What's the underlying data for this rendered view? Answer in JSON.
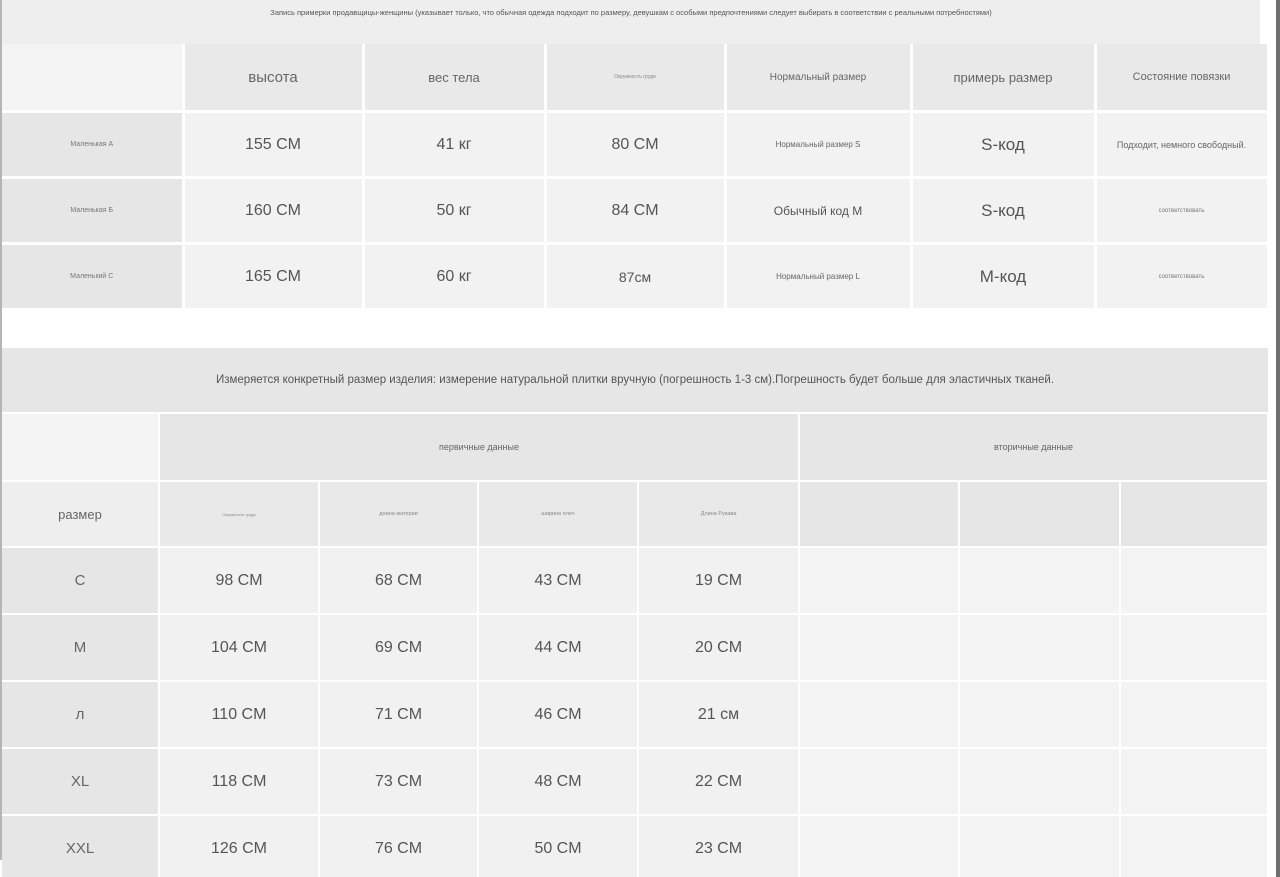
{
  "fitting_note": "Запись примерки продавщицы-женщины (указывает только, что обычная одежда подходит по размеру, девушкам с особыми предпочтениями следует выбирать в соответствии с реальными потребностями)",
  "fitting_table": {
    "headers": [
      "",
      "высота",
      "вес тела",
      "Окружность груди",
      "Нормальный размер",
      "примерь размер",
      "Состояние повязки"
    ],
    "rows": [
      [
        "Маленькая А",
        "155 CM",
        "41 кг",
        "80 CM",
        "Нормальный размер S",
        "S-код",
        "Подходит, немного свободный."
      ],
      [
        "Маленькая Б",
        "160 CM",
        "50 кг",
        "84 CM",
        "Обычный код M",
        "S-код",
        "соответствовать"
      ],
      [
        "Маленький С",
        "165 CM",
        "60 кг",
        "87см",
        "Нормальный размер L",
        "M-код",
        "соответствовать"
      ]
    ]
  },
  "measure_note": "Измеряется конкретный размер изделия: измерение натуральной плитки вручную (погрешность 1-3 см).Погрешность будет больше для эластичных тканей.",
  "size_table": {
    "group_primary": "первичные данные",
    "group_secondary": "вторичные данные",
    "size_header": "размер",
    "columns": [
      "Окружность груди",
      "длина материи",
      "ширина плеч",
      "Длина Рукава"
    ],
    "rows": [
      [
        "C",
        "98 CM",
        "68 CM",
        "43 CM",
        "19 CM"
      ],
      [
        "M",
        "104 CM",
        "69 CM",
        "44 CM",
        "20 CM"
      ],
      [
        "л",
        "110 CM",
        "71 CM",
        "46 CM",
        "21 см"
      ],
      [
        "XL",
        "118 CM",
        "73 CM",
        "48 CM",
        "22 CM"
      ],
      [
        "XXL",
        "126 CM",
        "76 CM",
        "50 CM",
        "23 CM"
      ]
    ]
  }
}
